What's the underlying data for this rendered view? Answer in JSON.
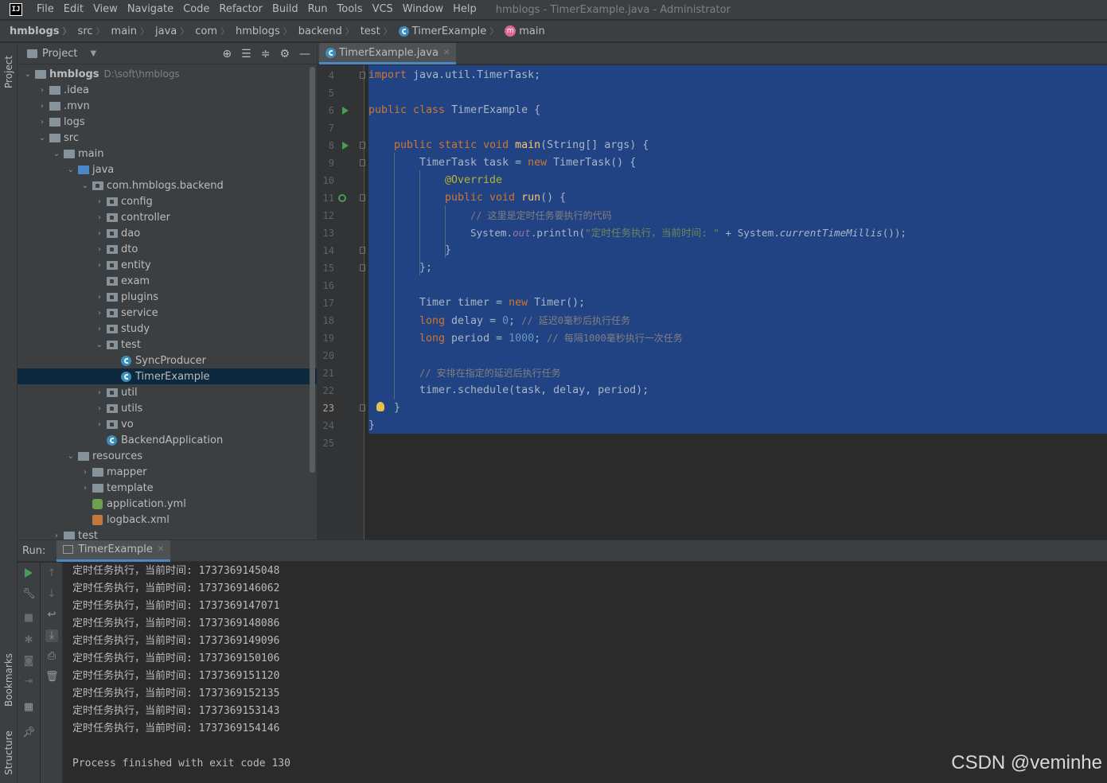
{
  "app": {
    "logo": "IJ",
    "window_title": "hmblogs - TimerExample.java - Administrator"
  },
  "menu": [
    "File",
    "Edit",
    "View",
    "Navigate",
    "Code",
    "Refactor",
    "Build",
    "Run",
    "Tools",
    "VCS",
    "Window",
    "Help"
  ],
  "breadcrumb": [
    "hmblogs",
    "src",
    "main",
    "java",
    "com",
    "hmblogs",
    "backend",
    "test",
    "TimerExample",
    "main"
  ],
  "left_strip": {
    "project": "Project",
    "bookmarks": "Bookmarks",
    "structure": "Structure"
  },
  "project_panel": {
    "title": "Project",
    "root_name": "hmblogs",
    "root_path": "D:\\soft\\hmblogs",
    "tree": [
      {
        "label": ".idea"
      },
      {
        "label": ".mvn"
      },
      {
        "label": "logs"
      },
      {
        "label": "src"
      },
      {
        "label": "main"
      },
      {
        "label": "java"
      },
      {
        "label": "com.hmblogs.backend"
      },
      {
        "label": "config"
      },
      {
        "label": "controller"
      },
      {
        "label": "dao"
      },
      {
        "label": "dto"
      },
      {
        "label": "entity"
      },
      {
        "label": "exam"
      },
      {
        "label": "plugins"
      },
      {
        "label": "service"
      },
      {
        "label": "study"
      },
      {
        "label": "test"
      },
      {
        "label": "SyncProducer"
      },
      {
        "label": "TimerExample"
      },
      {
        "label": "util"
      },
      {
        "label": "utils"
      },
      {
        "label": "vo"
      },
      {
        "label": "BackendApplication"
      },
      {
        "label": "resources"
      },
      {
        "label": "mapper"
      },
      {
        "label": "template"
      },
      {
        "label": "application.yml"
      },
      {
        "label": "logback.xml"
      },
      {
        "label": "test"
      }
    ]
  },
  "editor": {
    "tab_label": "TimerExample.java",
    "line_numbers": [
      "4",
      "5",
      "6",
      "7",
      "8",
      "9",
      "10",
      "11",
      "12",
      "13",
      "14",
      "15",
      "16",
      "17",
      "18",
      "19",
      "20",
      "21",
      "22",
      "23",
      "24",
      "25"
    ],
    "current_line": "23",
    "code": {
      "l4_kw": "import",
      "l4_rest": " java.util.TimerTask;",
      "l6_kw": "public class",
      "l6_rest": " TimerExample {",
      "l8_kw": "public static void",
      "l8_fn": "main",
      "l8_rest": "(String[] args) {",
      "l9_a": "TimerTask task = ",
      "l9_kw": "new",
      "l9_b": " TimerTask() {",
      "l10_ann": "@Override",
      "l11_kw": "public void",
      "l11_fn": "run",
      "l11_rest": "() {",
      "l12_cm": "// 这里是定时任务要执行的代码",
      "l13_a": "System.",
      "l13_fld": "out",
      "l13_b": ".println(",
      "l13_str": "\"定时任务执行，当前时间: \"",
      "l13_c": " + System.",
      "l13_it": "currentTimeMillis",
      "l13_d": "());",
      "l14": "}",
      "l15": "};",
      "l17_a": "Timer timer = ",
      "l17_kw": "new",
      "l17_b": " Timer();",
      "l18_kw": "long",
      "l18_a": " delay = ",
      "l18_num": "0",
      "l18_b": "; ",
      "l18_cm": "// 延迟0毫秒后执行任务",
      "l19_kw": "long",
      "l19_a": " period = ",
      "l19_num": "1000",
      "l19_b": "; ",
      "l19_cm": "// 每隔1000毫秒执行一次任务",
      "l21_cm": "// 安排在指定的延迟后执行任务",
      "l22": "timer.schedule(task, delay, period);",
      "l23": "}",
      "l24": "}"
    }
  },
  "run_panel": {
    "label": "Run:",
    "tab_label": "TimerExample",
    "output": [
      "定时任务执行，当前时间: 1737369145048",
      "定时任务执行，当前时间: 1737369146062",
      "定时任务执行，当前时间: 1737369147071",
      "定时任务执行，当前时间: 1737369148086",
      "定时任务执行，当前时间: 1737369149096",
      "定时任务执行，当前时间: 1737369150106",
      "定时任务执行，当前时间: 1737369151120",
      "定时任务执行，当前时间: 1737369152135",
      "定时任务执行，当前时间: 1737369153143",
      "定时任务执行，当前时间: 1737369154146"
    ],
    "exit_message": "Process finished with exit code 130"
  },
  "watermark": "CSDN @veminhe",
  "colors": {
    "selection": "#214283",
    "keyword": "#cc7832",
    "annotation": "#bbb529",
    "comment": "#808080",
    "string": "#6a8759",
    "number": "#6897bb",
    "accent": "#4a88c7"
  }
}
